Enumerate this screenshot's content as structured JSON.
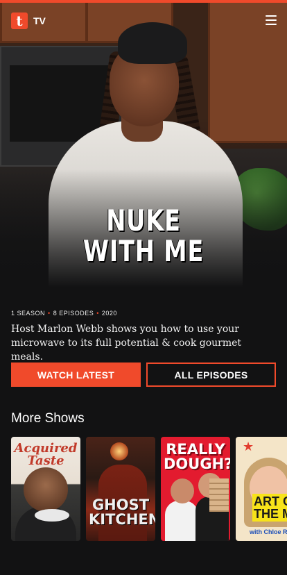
{
  "header": {
    "brand_letter": "t",
    "section_label": "TV",
    "menu_icon": "hamburger-menu-icon"
  },
  "hero": {
    "show_logo_line1": "NUKE",
    "show_logo_line2": "WITH ME"
  },
  "show": {
    "seasons": "1 SEASON",
    "episodes": "8 EPISODES",
    "year": "2020",
    "description": "Host Marlon Webb shows you how to use your microwave to its full potential & cook gourmet meals."
  },
  "actions": {
    "watch_latest": "WATCH LATEST",
    "all_episodes": "ALL EPISODES"
  },
  "more_shows": {
    "title": "More Shows",
    "items": [
      {
        "title": "Acquired Taste"
      },
      {
        "title": "GHOST KITCHEN"
      },
      {
        "title": "REALLY DOUGH?"
      },
      {
        "title": "ART OF THE MEAL",
        "subtitle": "with Chloe Ro"
      }
    ]
  },
  "colors": {
    "accent": "#f04a2b",
    "background": "#121213"
  }
}
